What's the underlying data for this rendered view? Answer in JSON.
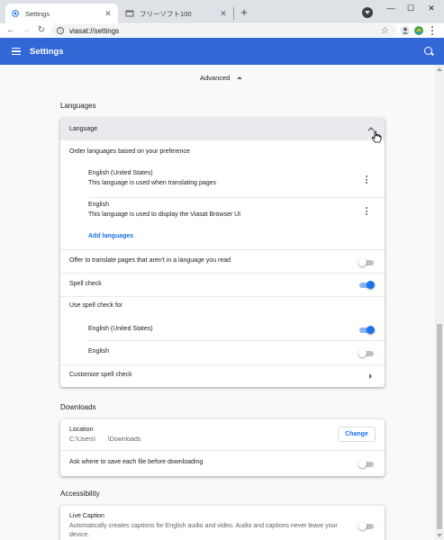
{
  "browser": {
    "tabs": [
      {
        "title": "Settings",
        "active": true
      },
      {
        "title": "フリーソフト100",
        "active": false
      }
    ],
    "new_tab_glyph": "+",
    "window_controls": [
      "—",
      "☐",
      "✕"
    ],
    "address": "viasat://settings",
    "icons": {
      "back": "back-arrow-icon",
      "forward": "forward-arrow-icon",
      "reload": "reload-icon",
      "site_info": "info-icon",
      "bookmark": "star-icon",
      "profile": "profile-icon",
      "extension": "extension-icon",
      "menu": "more-vert-icon"
    }
  },
  "header": {
    "title": "Settings",
    "color": "#3367d6"
  },
  "advanced_label": "Advanced",
  "languages": {
    "section_title": "Languages",
    "expander_label": "Language",
    "order_label": "Order languages based on your preference",
    "items": [
      {
        "name": "English (United States)",
        "desc": "This language is used when translating pages"
      },
      {
        "name": "English",
        "desc": "This language is used to display the Viasat Browser UI"
      }
    ],
    "add_languages": "Add languages",
    "offer_translate": {
      "label": "Offer to translate pages that aren't in a language you read",
      "on": false
    },
    "spell_check": {
      "label": "Spell check",
      "on": true
    },
    "use_spell_check_for": "Use spell check for",
    "spell_langs": [
      {
        "label": "English (United States)",
        "on": true
      },
      {
        "label": "English",
        "on": false
      }
    ],
    "customize_spell": "Customize spell check"
  },
  "downloads": {
    "section_title": "Downloads",
    "location_label": "Location",
    "location_path": "C:\\Users\\       \\Downloads",
    "change_button": "Change",
    "ask_where": {
      "label": "Ask where to save each file before downloading",
      "on": false
    }
  },
  "accessibility": {
    "section_title": "Accessibility",
    "live_caption_label": "Live Caption",
    "live_caption_desc_1": "Automatically creates captions for English audio and video. Audio and captions never leave your",
    "live_caption_desc_2": "device.",
    "live_caption_on": false
  },
  "colors": {
    "accent": "#1a73e8",
    "toggle_on_track": "#8ab4f8",
    "toggle_off_track": "#bdc1c6"
  }
}
